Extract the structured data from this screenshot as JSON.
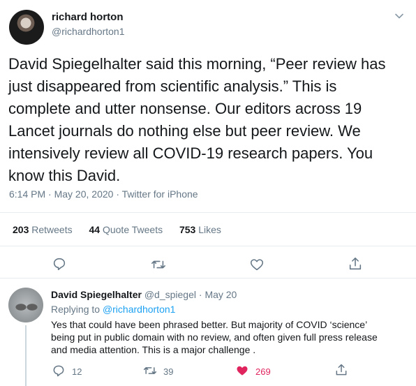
{
  "tweet": {
    "author_name": "richard horton",
    "author_handle": "@richardhorton1",
    "text": "David Spiegelhalter said this morning, “Peer review has\njust disappeared from scientific analysis.” This is\ncomplete and utter nonsense. Our editors across 19\nLancet journals do nothing else but peer review. We\nintensively review all COVID-19 research papers. You\nknow this David.",
    "time": "6:14 PM",
    "date": "May 20, 2020",
    "source": "Twitter for iPhone",
    "separator": " · ",
    "stats": {
      "retweets_count": "203",
      "retweets_label": " Retweets",
      "quotes_count": "44",
      "quotes_label": " Quote Tweets",
      "likes_count": "753",
      "likes_label": " Likes"
    }
  },
  "reply": {
    "author_name": "David Spiegelhalter",
    "author_handle": "@d_spiegel",
    "date": "May 20",
    "separator": " · ",
    "replying_prefix": "Replying to ",
    "replying_to": "@richardhorton1",
    "text": "Yes that could have been phrased better. But majority of  COVID ‘science’\nbeing put in public domain with no review, and often given full press release\nand media attention. This is a major challenge .",
    "reply_count": "12",
    "retweet_count": "39",
    "like_count": "269"
  },
  "colors": {
    "accent": "#1da1f2",
    "secondary_text": "#657786",
    "like_active": "#e0245e"
  },
  "icons": [
    "caret-down-icon",
    "reply-icon",
    "retweet-icon",
    "like-icon",
    "share-icon"
  ]
}
